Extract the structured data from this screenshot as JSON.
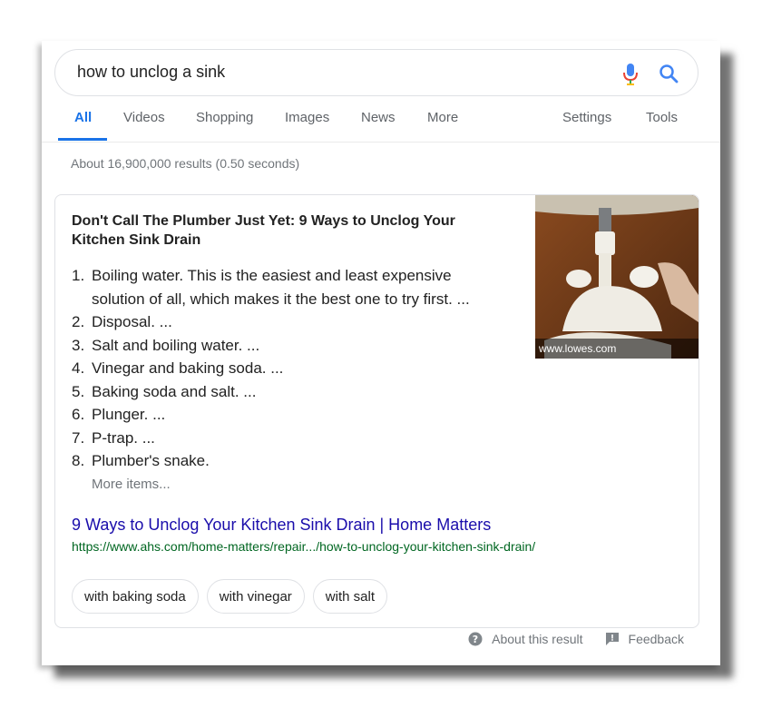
{
  "search": {
    "query": "how to unclog a sink",
    "mic_icon": "microphone-icon",
    "search_icon": "magnifier-icon"
  },
  "tabs": {
    "items": [
      {
        "label": "All",
        "active": true
      },
      {
        "label": "Videos"
      },
      {
        "label": "Shopping"
      },
      {
        "label": "Images"
      },
      {
        "label": "News"
      },
      {
        "label": "More"
      }
    ],
    "settings_label": "Settings",
    "tools_label": "Tools",
    "accent_color": "#1a73e8"
  },
  "stats": "About 16,900,000 results (0.50 seconds)",
  "snippet": {
    "title": "Don't Call The Plumber Just Yet: 9 Ways to Unclog Your Kitchen Sink Drain",
    "list": [
      {
        "num": "1.",
        "text": "Boiling water. This is the easiest and least expensive solution of all, which makes it the best one to try first. ..."
      },
      {
        "num": "2.",
        "text": "Disposal. ..."
      },
      {
        "num": "3.",
        "text": "Salt and boiling water. ..."
      },
      {
        "num": "4.",
        "text": "Vinegar and baking soda. ..."
      },
      {
        "num": "5.",
        "text": "Baking soda and salt. ..."
      },
      {
        "num": "6.",
        "text": "Plunger. ..."
      },
      {
        "num": "7.",
        "text": "P-trap. ..."
      },
      {
        "num": "8.",
        "text": "Plumber's snake."
      }
    ],
    "more_items": "More items...",
    "image_caption": "www.lowes.com",
    "link_title": "9 Ways to Unclog Your Kitchen Sink Drain | Home Matters",
    "link_url": "https://www.ahs.com/home-matters/repair.../how-to-unclog-your-kitchen-sink-drain/",
    "chips": [
      "with baking soda",
      "with vinegar",
      "with salt"
    ]
  },
  "footer": {
    "about_label": "About this result",
    "about_icon": "question-circle-icon",
    "feedback_label": "Feedback",
    "feedback_icon": "feedback-icon"
  }
}
